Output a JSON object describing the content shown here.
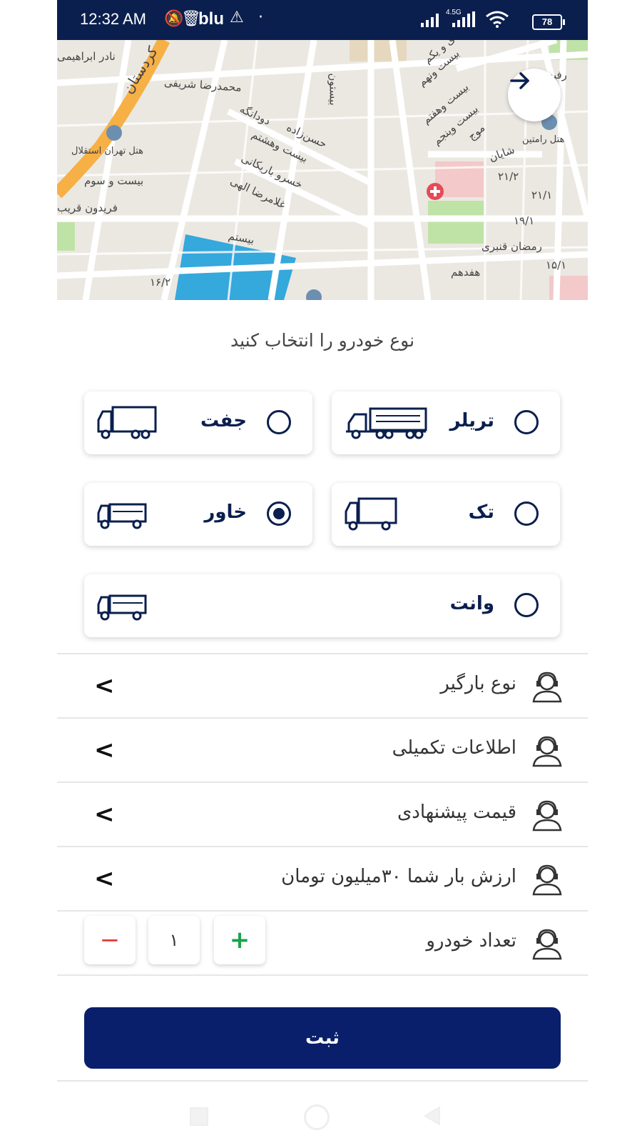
{
  "status_bar": {
    "time": "12:32 AM",
    "carrier": "blu",
    "battery": "78",
    "network": "4.5G"
  },
  "map": {
    "labels": {
      "l1": "نادر ابراهیمی",
      "l2": "کردستان",
      "l3": "محمدرضا شریفی",
      "l4": "هتل تهران استقلال",
      "l5": "بیست و سوم",
      "l6": "فریدون قریب",
      "l7": "دودانگه",
      "l8": "حسن‌زاده",
      "l9": "بیست وهشتم",
      "l10": "خسرو باریکانی",
      "l11": "غلامرضا الهی",
      "l12": "بیستم",
      "l13": "بیستون",
      "l14": "بیست ونهم",
      "l15": "بیست وهفتم",
      "l16": "بیست وپنجم",
      "l17": "موج",
      "l18": "شایان",
      "l19": "۲۱/۲",
      "l20": "۲۱/۱",
      "l21": "۱۹/۱",
      "l22": "رمضان قنبری",
      "l23": "هفدهم",
      "l24": "۱۵/۱",
      "l25": "هتل رامتین",
      "l26": "رفیع",
      "l27": "۱۶/۲",
      "l28": "ی و یکم"
    }
  },
  "heading": "نوع خودرو را انتخاب کنید",
  "vehicles": {
    "trailer": "تریلر",
    "joft": "جفت",
    "tak": "تک",
    "khavar": "خاور",
    "vanet": "وانت"
  },
  "rows": {
    "cargo_type": "نوع بارگیر",
    "extra_info": "اطلاعات تکمیلی",
    "offer_price": "قیمت پیشنهادی",
    "cargo_value": "ارزش بار شما ۳۰میلیون تومان",
    "vehicle_count": "تعداد خودرو"
  },
  "stepper": {
    "value": "۱",
    "plus": "+",
    "minus": "−"
  },
  "submit_label": "ثبت",
  "colors": {
    "primary": "#0a1f4e",
    "button": "#0a1f6b",
    "plus": "#1aa34a",
    "minus": "#e53935"
  }
}
